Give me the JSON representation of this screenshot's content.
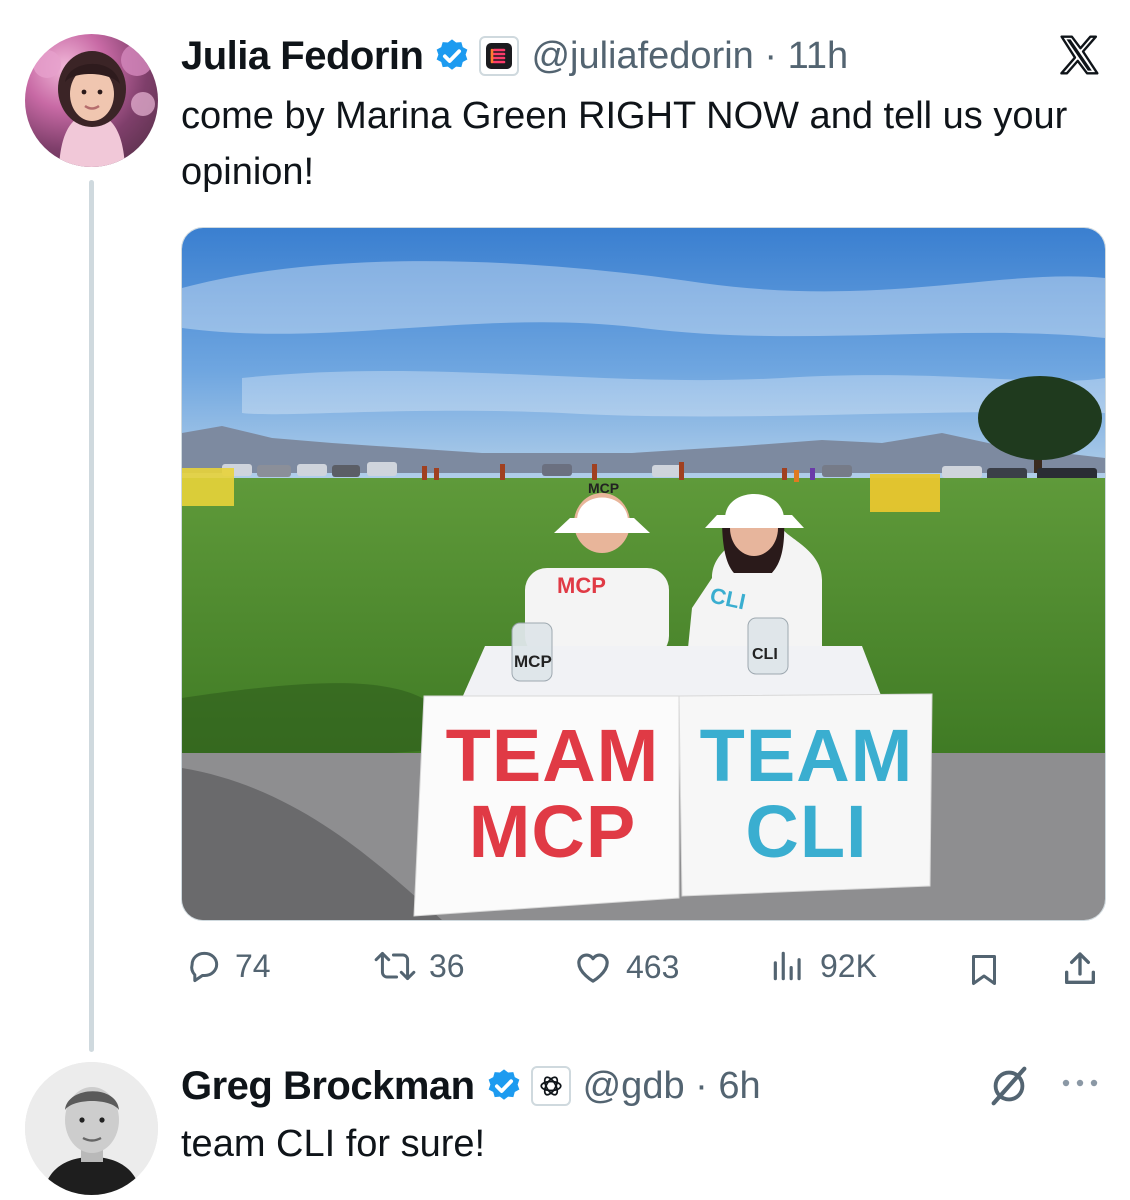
{
  "tweet1": {
    "author_name": "Julia Fedorin",
    "handle_time": "@juliafedorin · 11h",
    "text": "come by Marina Green RIGHT NOW and tell us your opinion!",
    "photo": {
      "sign_left": "TEAM MCP",
      "sign_right": "TEAM CLI",
      "shirt_left": "MCP",
      "shirt_right": "CLI",
      "hat_left": "MCP",
      "jar_left": "MCP",
      "jar_right": "CLI"
    },
    "metrics": {
      "replies": "74",
      "retweets": "36",
      "likes": "463",
      "views": "92K"
    },
    "icons": [
      "verified-badge-icon",
      "affiliate-badge-icon",
      "x-logo-icon",
      "reply-icon",
      "retweet-icon",
      "like-icon",
      "views-icon",
      "bookmark-icon",
      "share-icon"
    ]
  },
  "tweet2": {
    "author_name": "Greg Brockman",
    "handle_time": "@gdb · 6h",
    "text": "team CLI for sure!",
    "icons": [
      "verified-badge-icon",
      "openai-badge-icon",
      "grok-icon",
      "more-icon"
    ]
  },
  "colors": {
    "verified_blue": "#1d9bf0",
    "secondary_text": "#536471",
    "thread_line": "#cfd9de",
    "team_mcp_red": "#e03a45",
    "team_cli_blue": "#3aaed0"
  }
}
